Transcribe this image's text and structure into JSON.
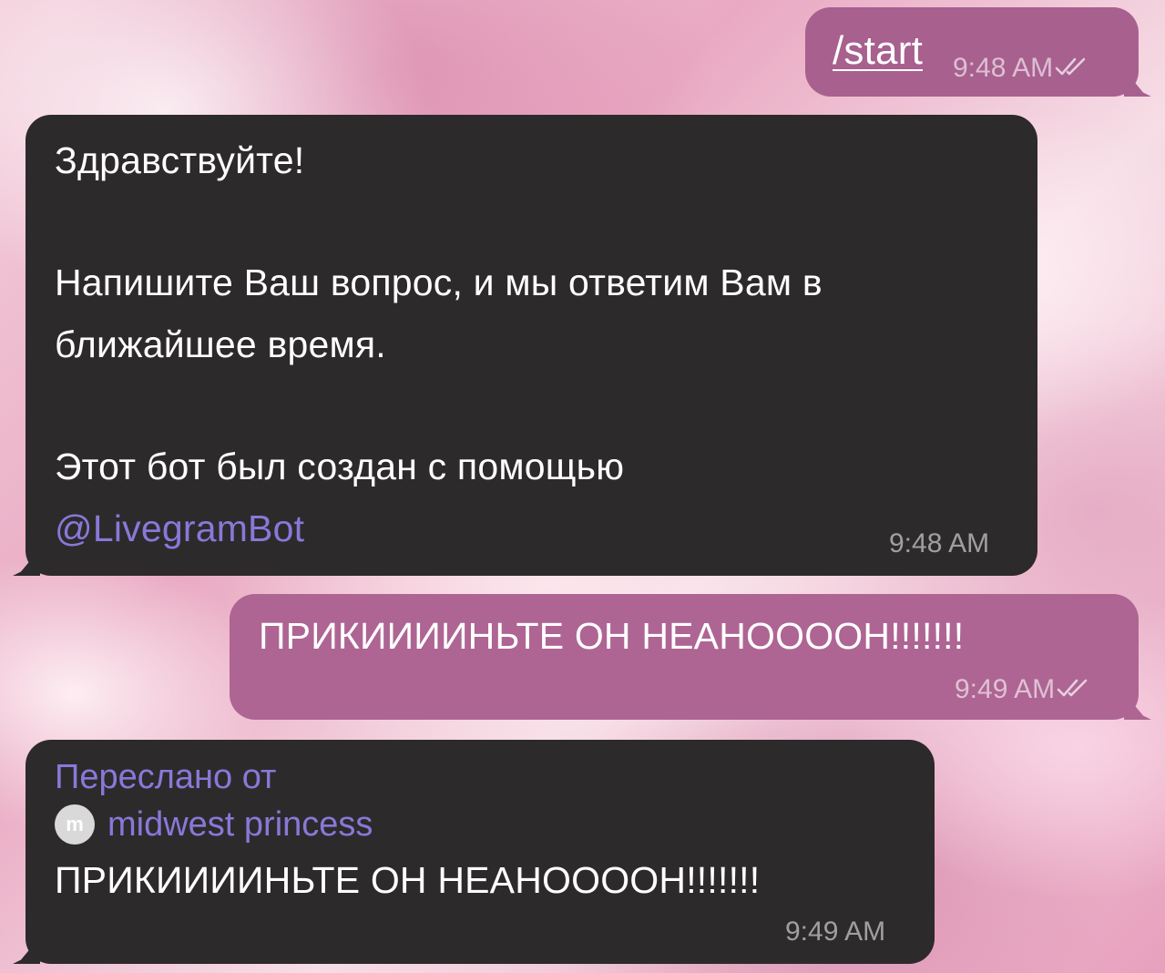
{
  "chat": {
    "messages": [
      {
        "direction": "outgoing",
        "text": "/start",
        "time": "9:48 AM",
        "status": "read",
        "status_icon": "double-check-icon"
      },
      {
        "direction": "incoming",
        "lines": [
          "Здравствуйте!",
          "Напишите Ваш вопрос, и мы ответим Вам в",
          "ближайшее время.",
          "Этот бот был создан с помощью"
        ],
        "mention": "@LivegramBot",
        "time": "9:48 AM"
      },
      {
        "direction": "outgoing",
        "text": "ПРИКИИИИНЬТЕ ОН НЕАНООООН!!!!!!!",
        "time": "9:49 AM",
        "status": "read",
        "status_icon": "double-check-icon"
      },
      {
        "direction": "incoming",
        "forwarded_label": "Переслано от",
        "forwarded_avatar_letter": "m",
        "forwarded_from": "midwest princess",
        "text": "ПРИКИИИИНЬТЕ ОН НЕАНООООН!!!!!!!",
        "time": "9:49 AM"
      }
    ]
  },
  "colors": {
    "outgoing_bubble": "#a8608f",
    "incoming_bubble": "#2d2a2c",
    "link": "#8a78d8",
    "background": "#f3cfdc"
  }
}
